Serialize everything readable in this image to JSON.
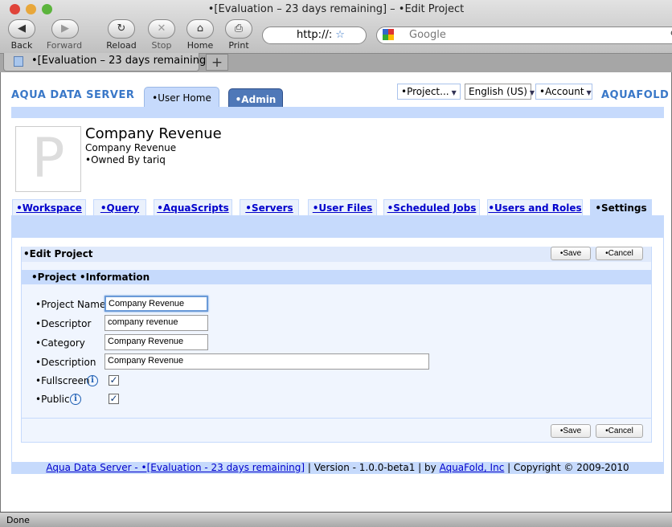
{
  "browser": {
    "window_title": "•[Evaluation – 23 days remaining] – •Edit Project",
    "back": "Back",
    "forward": "Forward",
    "reload": "Reload",
    "stop": "Stop",
    "home": "Home",
    "print": "Print",
    "url": "http://:",
    "search_placeholder": "Google",
    "tab_title": "•[Evaluation – 23 days remaining]...",
    "new_tab": "+",
    "status": "Done"
  },
  "header": {
    "logo_left": "AQUA DATA SERVER",
    "logo_right": "AQUAFOLD",
    "top_tabs": [
      {
        "label": "•User Home",
        "active": true
      },
      {
        "label": "•Admin",
        "active": false
      }
    ],
    "project_menu": "•Project...",
    "language_menu": "English (US)",
    "account_menu": "•Account"
  },
  "project": {
    "avatar_letter": "P",
    "title": "Company Revenue",
    "subtitle": "Company Revenue",
    "owner": "•Owned By tariq"
  },
  "nav_tabs": [
    {
      "label": "•Workspace"
    },
    {
      "label": "•Query"
    },
    {
      "label": "•AquaScripts"
    },
    {
      "label": "•Servers"
    },
    {
      "label": "•User Files"
    },
    {
      "label": "•Scheduled Jobs"
    },
    {
      "label": "•Users and Roles"
    },
    {
      "label": "•Settings",
      "active": true
    }
  ],
  "edit": {
    "heading": "•Edit Project",
    "save": "•Save",
    "cancel": "•Cancel",
    "section": "•Project •Information",
    "fields": {
      "name_label": "•Project Name",
      "name_value": "Company Revenue",
      "descriptor_label": "•Descriptor",
      "descriptor_value": "company revenue",
      "category_label": "•Category",
      "category_value": "Company Revenue",
      "description_label": "•Description",
      "description_value": "Company Revenue",
      "fullscreen_label": "•Fullscreen",
      "fullscreen_checked": true,
      "public_label": "•Public",
      "public_checked": true
    }
  },
  "footer": {
    "link1": "Aqua Data Server - •[Evaluation - 23 days remaining]",
    "version": " | Version - 1.0.0-beta1 | by ",
    "link2": "AquaFold, Inc",
    "copyright": " | Copyright © 2009-2010"
  },
  "colors": {
    "accent": "#c6dafc",
    "admin_tab": "#4f78b8",
    "link": "#0000cc"
  }
}
